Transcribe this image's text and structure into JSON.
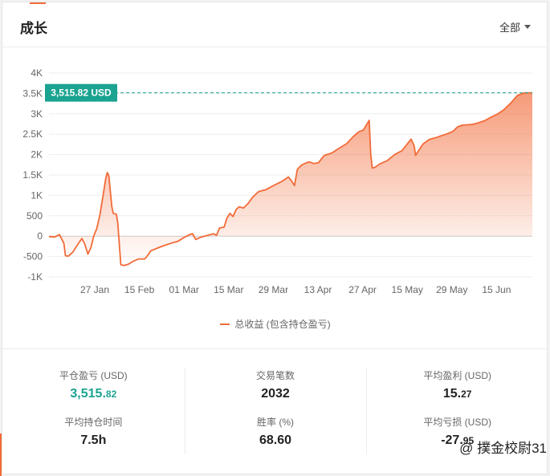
{
  "header": {
    "title": "成长",
    "range_label": "全部"
  },
  "marker_label": "3,515.82 USD",
  "legend": {
    "label": "总收益 (包含持仓盈亏)"
  },
  "chart_data": {
    "type": "area",
    "xlabel": "",
    "ylabel": "",
    "x_ticks": [
      "27 Jan",
      "15 Feb",
      "01 Mar",
      "15 Mar",
      "29 Mar",
      "13 Apr",
      "27 Apr",
      "15 May",
      "29 May",
      "15 Jun"
    ],
    "y_ticks": [
      "4K",
      "3.5K",
      "3K",
      "2.5K",
      "2K",
      "1.5K",
      "1K",
      "500",
      "0",
      "-500",
      "-1K"
    ],
    "ylim": [
      -1000,
      4000
    ],
    "x_range": [
      0,
      149
    ],
    "reference_line": 3515.82,
    "series": [
      {
        "values": [
          [
            0,
            -10
          ],
          [
            4,
            -20
          ],
          [
            7,
            40
          ],
          [
            10,
            -180
          ],
          [
            11,
            -480
          ],
          [
            13,
            -490
          ],
          [
            16,
            -390
          ],
          [
            20,
            -160
          ],
          [
            22,
            -60
          ],
          [
            24,
            -200
          ],
          [
            26,
            -440
          ],
          [
            28,
            -280
          ],
          [
            30,
            10
          ],
          [
            32,
            190
          ],
          [
            34,
            520
          ],
          [
            36,
            960
          ],
          [
            38,
            1430
          ],
          [
            39,
            1560
          ],
          [
            40,
            1480
          ],
          [
            41,
            1100
          ],
          [
            42,
            720
          ],
          [
            43,
            560
          ],
          [
            45,
            540
          ],
          [
            46,
            320
          ],
          [
            47,
            -200
          ],
          [
            48,
            -700
          ],
          [
            50,
            -720
          ],
          [
            53,
            -690
          ],
          [
            56,
            -620
          ],
          [
            60,
            -560
          ],
          [
            64,
            -560
          ],
          [
            66,
            -470
          ],
          [
            68,
            -360
          ],
          [
            72,
            -300
          ],
          [
            77,
            -230
          ],
          [
            82,
            -170
          ],
          [
            86,
            -130
          ],
          [
            90,
            -40
          ],
          [
            94,
            40
          ],
          [
            96,
            60
          ],
          [
            98,
            -80
          ],
          [
            102,
            -20
          ],
          [
            106,
            20
          ],
          [
            110,
            60
          ],
          [
            112,
            20
          ],
          [
            114,
            200
          ],
          [
            117,
            220
          ],
          [
            119,
            450
          ],
          [
            121,
            560
          ],
          [
            123,
            480
          ],
          [
            125,
            650
          ],
          [
            127,
            720
          ],
          [
            130,
            690
          ],
          [
            133,
            800
          ],
          [
            136,
            950
          ],
          [
            140,
            1090
          ],
          [
            145,
            1140
          ],
          [
            150,
            1240
          ],
          [
            155,
            1330
          ],
          [
            160,
            1450
          ],
          [
            162,
            1360
          ],
          [
            164,
            1240
          ],
          [
            166,
            1640
          ],
          [
            169,
            1750
          ],
          [
            172,
            1800
          ],
          [
            174,
            1820
          ],
          [
            177,
            1780
          ],
          [
            180,
            1800
          ],
          [
            184,
            1980
          ],
          [
            189,
            2040
          ],
          [
            194,
            2160
          ],
          [
            199,
            2270
          ],
          [
            203,
            2430
          ],
          [
            207,
            2560
          ],
          [
            210,
            2600
          ],
          [
            213,
            2780
          ],
          [
            214,
            2840
          ],
          [
            215,
            2020
          ],
          [
            216,
            1670
          ],
          [
            218,
            1690
          ],
          [
            221,
            1770
          ],
          [
            226,
            1850
          ],
          [
            231,
            2000
          ],
          [
            236,
            2100
          ],
          [
            239,
            2240
          ],
          [
            242,
            2380
          ],
          [
            244,
            2220
          ],
          [
            245,
            1980
          ],
          [
            247,
            2100
          ],
          [
            250,
            2260
          ],
          [
            254,
            2370
          ],
          [
            258,
            2410
          ],
          [
            262,
            2460
          ],
          [
            266,
            2510
          ],
          [
            270,
            2570
          ],
          [
            273,
            2680
          ],
          [
            276,
            2720
          ],
          [
            279,
            2730
          ],
          [
            283,
            2740
          ],
          [
            287,
            2780
          ],
          [
            291,
            2830
          ],
          [
            296,
            2930
          ],
          [
            300,
            3000
          ],
          [
            304,
            3100
          ],
          [
            309,
            3280
          ],
          [
            313,
            3450
          ],
          [
            318,
            3515.82
          ],
          [
            323,
            3515.82
          ]
        ]
      }
    ]
  },
  "stats": [
    {
      "label": "平仓盈亏 (USD)",
      "int": "3,515.",
      "frac": "82",
      "accent": "#1aa390"
    },
    {
      "label": "交易笔数",
      "int": "2032",
      "frac": ""
    },
    {
      "label": "平均盈利 (USD)",
      "int": "15.",
      "frac": "27"
    },
    {
      "label": "平均持仓时间",
      "int": "7.5h",
      "frac": ""
    },
    {
      "label": "胜率 (%)",
      "int": "68.60",
      "frac": ""
    },
    {
      "label": "平均亏损 (USD)",
      "int": "-27.",
      "frac": "95"
    }
  ],
  "watermark": {
    "text": "@ 撲金校尉31"
  },
  "colors": {
    "line": "#f26b38",
    "reference": "#1aa390",
    "grid": "#eeeeee",
    "zero": "#cccccc"
  }
}
